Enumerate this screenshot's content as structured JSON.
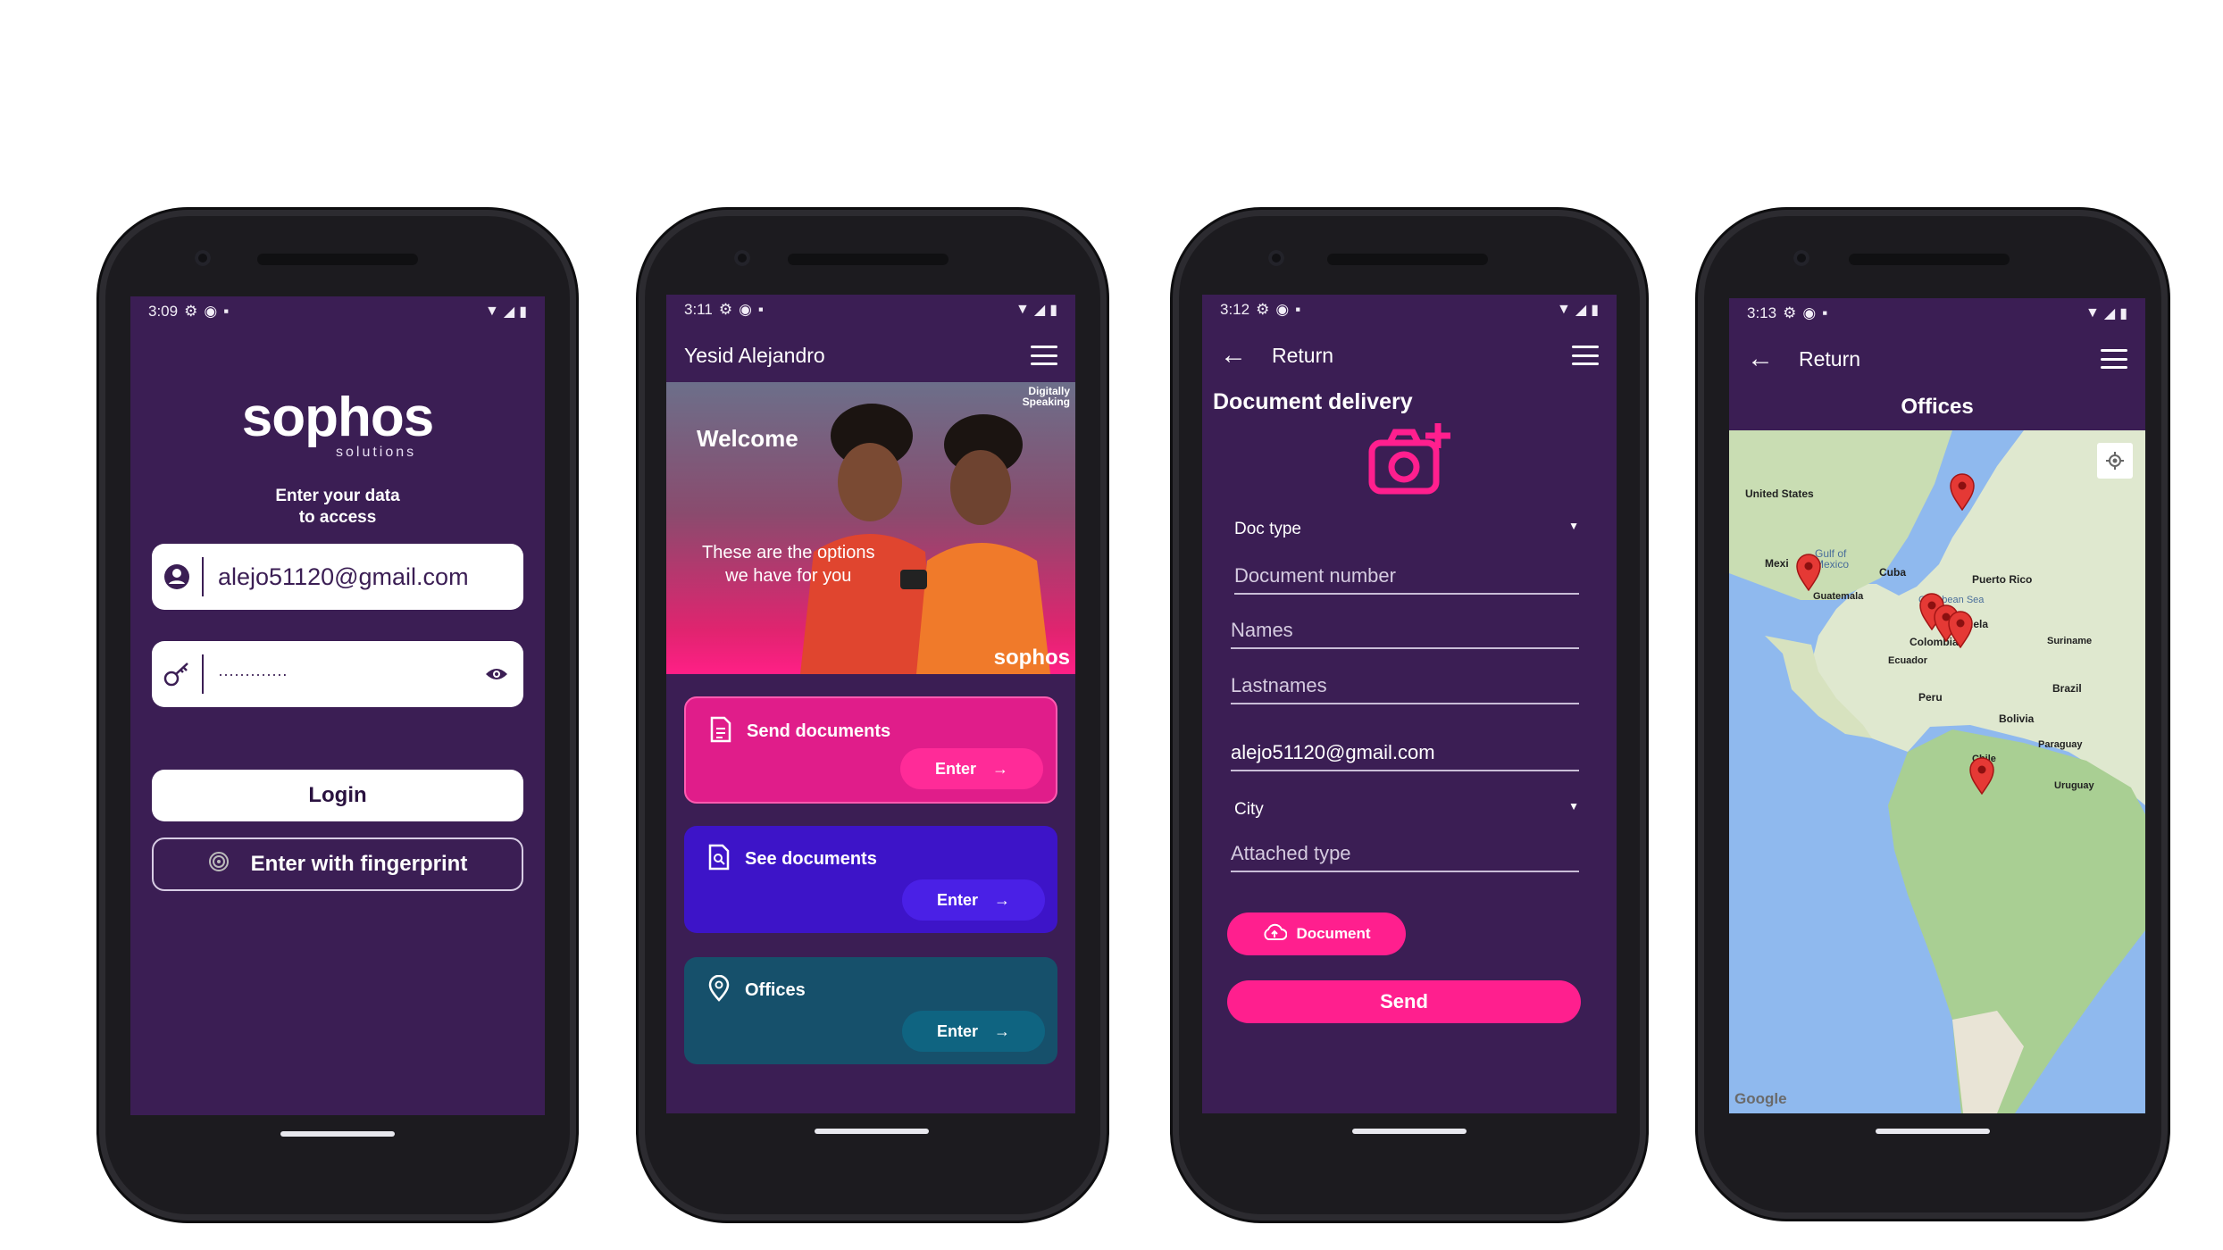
{
  "colors": {
    "screen_bg": "#3b1e54",
    "accent_pink": "#ff1f8e",
    "card_pink": "#e01d8a",
    "card_purple": "#3d14c8",
    "card_teal": "#16506b"
  },
  "phone1": {
    "status_time": "3:09",
    "logo": "sophos",
    "logo_sub": "solutions",
    "prompt_line1": "Enter your data",
    "prompt_line2": "to access",
    "email_value": "alejo51120@gmail.com",
    "password_value": "·············",
    "login_label": "Login",
    "fingerprint_label": "Enter with fingerprint"
  },
  "phone2": {
    "status_time": "3:11",
    "user_name": "Yesid Alejandro",
    "hero_badge_line1": "Digitally",
    "hero_badge_line2": "Speaking",
    "welcome": "Welcome",
    "options_line1": "These are the options",
    "options_line2": "we have for you",
    "hero_logo": "sophos",
    "cards": [
      {
        "title": "Send documents",
        "enter": "Enter"
      },
      {
        "title": "See documents",
        "enter": "Enter"
      },
      {
        "title": "Offices",
        "enter": "Enter"
      }
    ]
  },
  "phone3": {
    "status_time": "3:12",
    "back_label": "Return",
    "heading": "Document delivery",
    "doc_type": "Doc type",
    "document_number": "Document number",
    "names": "Names",
    "lastnames": "Lastnames",
    "email_value": "alejo51120@gmail.com",
    "city": "City",
    "attached_type": "Attached type",
    "document_button": "Document",
    "send_button": "Send"
  },
  "phone4": {
    "status_time": "3:13",
    "back_label": "Return",
    "heading": "Offices",
    "map_labels": {
      "united_states": "United States",
      "gulf": "Gulf of Mexico",
      "mexico": "Mexi",
      "cuba": "Cuba",
      "puerto_rico": "Puerto Rico",
      "guatemala": "Guatemala",
      "caribbean": "Caribbean Sea",
      "venezuela": "Venezuela",
      "colombia": "Colombia",
      "suriname": "Suriname",
      "ecuador": "Ecuador",
      "peru": "Peru",
      "brazil": "Brazil",
      "bolivia": "Bolivia",
      "paraguay": "Paraguay",
      "chile": "Chile",
      "uruguay": "Uruguay",
      "google": "Google"
    }
  }
}
